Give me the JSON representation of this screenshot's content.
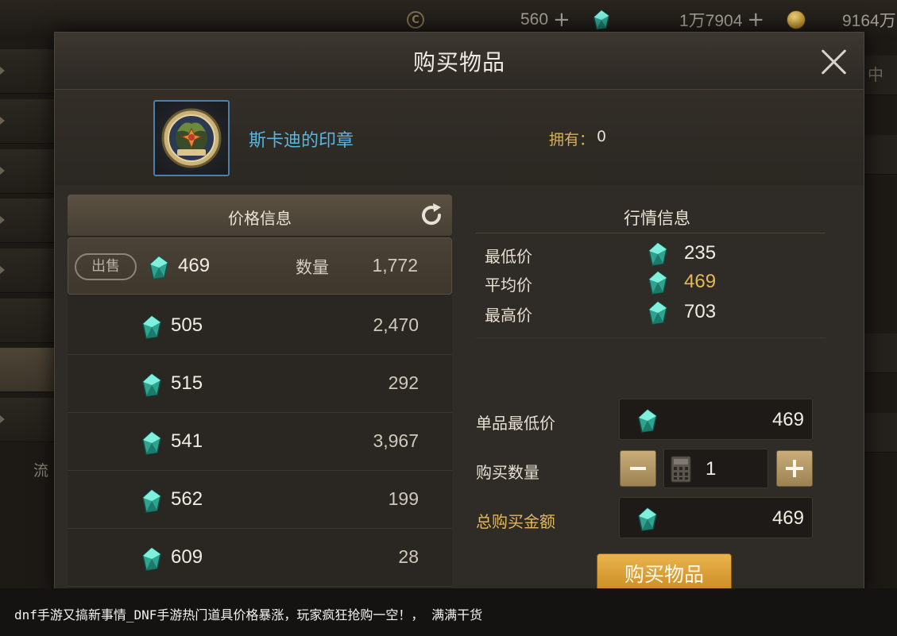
{
  "topbar": {
    "currency1": {
      "icon": "c-coin-icon",
      "value": "560",
      "plus": "+"
    },
    "currency2": {
      "icon": "gem-icon",
      "value": "1万7904",
      "plus": "+"
    },
    "currency3": {
      "icon": "gold-coin-icon",
      "value": "9164万"
    }
  },
  "background": {
    "side_text": "流",
    "right_text": "中"
  },
  "dialog": {
    "title": "购买物品",
    "close_icon": "close-icon"
  },
  "item": {
    "name": "斯卡迪的印章",
    "owned_label": "拥有：",
    "owned_value": "0",
    "icon": "seal-icon"
  },
  "price_panel": {
    "title": "价格信息",
    "refresh_icon": "refresh-icon",
    "sell_badge": "出售",
    "qty_label": "数量",
    "rows": [
      {
        "price": "469",
        "qty": "1,772"
      },
      {
        "price": "505",
        "qty": "2,470"
      },
      {
        "price": "515",
        "qty": "292"
      },
      {
        "price": "541",
        "qty": "3,967"
      },
      {
        "price": "562",
        "qty": "199"
      },
      {
        "price": "609",
        "qty": "28"
      }
    ]
  },
  "market_panel": {
    "title": "行情信息",
    "min_label": "最低价",
    "min_value": "235",
    "avg_label": "平均价",
    "avg_value": "469",
    "max_label": "最高价",
    "max_value": "703"
  },
  "purchase_form": {
    "unit_min_label": "单品最低价",
    "unit_min_value": "469",
    "qty_label": "购买数量",
    "qty_value": "1",
    "minus": "−",
    "plus": "+",
    "total_label": "总购买金额",
    "total_value": "469",
    "buy_button": "购买物品"
  },
  "caption": "dnf手游又搞新事情_DNF手游热门道具价格暴涨，玩家疯狂抢购一空！， 满满干货",
  "colors": {
    "gem": "#3fc6b0",
    "accent_gold": "#e3b95a",
    "item_name": "#58b7e0",
    "buy_button": "#d89a2e"
  }
}
